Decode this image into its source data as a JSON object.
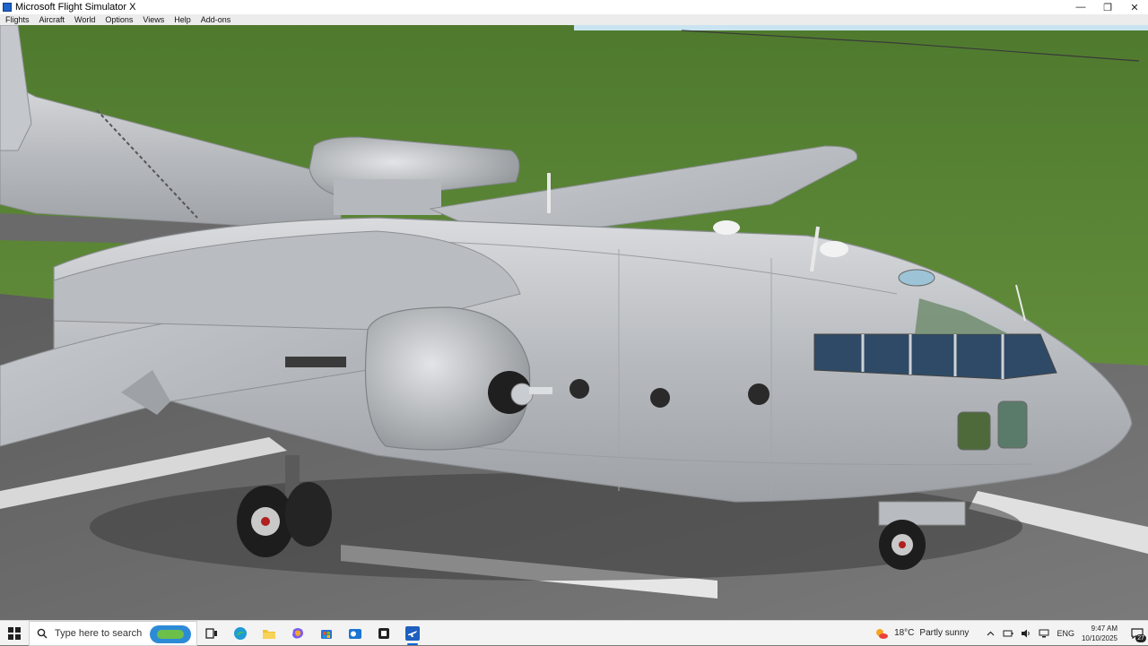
{
  "window": {
    "title": "Microsoft Flight Simulator X",
    "icon": "fsx-app-icon",
    "controls": [
      "minimize",
      "restore",
      "close"
    ]
  },
  "menu": {
    "items": [
      {
        "label": "Flights"
      },
      {
        "label": "Aircraft"
      },
      {
        "label": "World"
      },
      {
        "label": "Options"
      },
      {
        "label": "Views"
      },
      {
        "label": "Help"
      },
      {
        "label": "Add-ons"
      }
    ]
  },
  "scene": {
    "description_icon": "sim-3d-view",
    "colors": {
      "grass": "#5f8a38",
      "sky": "#c9e4f0",
      "tarmac": "#6e6e6e",
      "fuselage": "#c2c5c9",
      "runway_marking": "#e8e8e8"
    }
  },
  "taskbar": {
    "search": {
      "placeholder": "Type here to search"
    },
    "pinned": [
      {
        "name": "task-view",
        "icon": "task-view-icon"
      },
      {
        "name": "edge",
        "icon": "edge-icon"
      },
      {
        "name": "file-explorer",
        "icon": "folder-icon"
      },
      {
        "name": "copilot",
        "icon": "copilot-icon"
      },
      {
        "name": "microsoft-store",
        "icon": "store-icon"
      },
      {
        "name": "outlook",
        "icon": "outlook-icon"
      },
      {
        "name": "app",
        "icon": "app-icon"
      },
      {
        "name": "flight-simulator",
        "icon": "plane-icon",
        "active": true
      }
    ],
    "weather": {
      "temp": "18°C",
      "condition": "Partly sunny"
    },
    "language": "ENG",
    "clock": {
      "time": "9:47 AM",
      "date": "10/10/2025"
    },
    "notifications": {
      "count": "27"
    }
  }
}
